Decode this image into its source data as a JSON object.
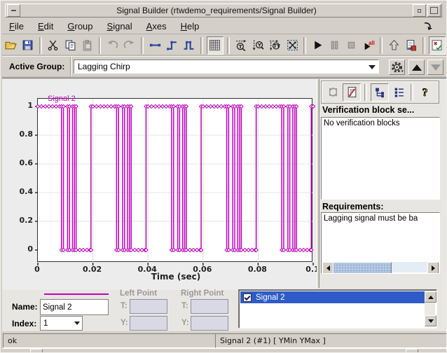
{
  "window": {
    "title": "Signal Builder (rtwdemo_requirements/Signal Builder)"
  },
  "menu": {
    "items": [
      "File",
      "Edit",
      "Group",
      "Signal",
      "Axes",
      "Help"
    ]
  },
  "toolbar": {
    "groups": [
      [
        {
          "name": "open",
          "icon": "folder-open-icon"
        },
        {
          "name": "save",
          "icon": "save-icon"
        }
      ],
      [
        {
          "name": "cut",
          "icon": "scissors-icon"
        },
        {
          "name": "copy",
          "icon": "copy-icon"
        },
        {
          "name": "paste",
          "icon": "paste-icon",
          "disabled": true
        }
      ],
      [
        {
          "name": "undo",
          "icon": "undo-icon",
          "disabled": true
        },
        {
          "name": "redo",
          "icon": "redo-icon",
          "disabled": true
        }
      ],
      [
        {
          "name": "line-segment",
          "icon": "line-segment-icon"
        },
        {
          "name": "step-signal",
          "icon": "step-icon"
        },
        {
          "name": "pulse-signal",
          "icon": "pulse-icon"
        }
      ],
      [
        {
          "name": "grid-toggle",
          "icon": "grid-icon",
          "pressed": true
        }
      ],
      [
        {
          "name": "zoom-time",
          "icon": "zoom-t-icon"
        },
        {
          "name": "zoom-y",
          "icon": "zoom-y-icon"
        },
        {
          "name": "zoom-ty",
          "icon": "zoom-ty-icon"
        },
        {
          "name": "zoom-fit",
          "icon": "zoom-fit-icon"
        }
      ],
      [
        {
          "name": "start-simulation",
          "icon": "play-icon"
        },
        {
          "name": "pause-simulation",
          "icon": "pause-icon",
          "disabled": true
        },
        {
          "name": "stop-simulation",
          "icon": "stop-icon",
          "disabled": true
        },
        {
          "name": "run-all-groups",
          "icon": "play-all-icon"
        }
      ],
      [
        {
          "name": "up-to-parent",
          "icon": "up-arrow-icon"
        },
        {
          "name": "send-to-workspace",
          "icon": "export-icon"
        }
      ],
      [
        {
          "name": "requirements-display",
          "icon": "verification-icon",
          "pressed": true
        }
      ]
    ]
  },
  "active_group": {
    "label": "Active Group:",
    "value": "Lagging Chirp"
  },
  "right_panel": {
    "toolbar": [
      {
        "name": "run-verification",
        "icon": "run-verification-icon",
        "disabled": true
      },
      {
        "name": "requirements-doc",
        "icon": "requirements-doc-icon",
        "pressed": true
      },
      {
        "name": "tree-view",
        "icon": "tree-view-icon",
        "pressed": true
      },
      {
        "name": "list-view",
        "icon": "list-view-icon"
      },
      {
        "name": "help",
        "icon": "help-icon"
      }
    ],
    "verification_header": "Verification block se...",
    "verification_text": "No verification blocks",
    "requirements_header": "Requirements:",
    "requirements_text": "Lagging signal must be ba"
  },
  "signal_panel": {
    "left_point_label": "Left Point",
    "right_point_label": "Right Point",
    "name_label": "Name:",
    "name_value": "Signal 2",
    "index_label": "Index:",
    "index_value": "1",
    "t_label": "T:",
    "y_label": "Y:"
  },
  "signal_list": {
    "items": [
      {
        "label": "Signal 2",
        "checked": true,
        "selected": true
      }
    ]
  },
  "status_bar": {
    "left": "ok",
    "right": "Signal 2 (#1)  [ YMin YMax ]"
  },
  "chart_data": {
    "type": "line",
    "style": "square-wave-with-markers",
    "title": "Signal 2",
    "xlabel": "Time (sec)",
    "color": "#bf00bf",
    "grid": true,
    "xlim": [
      0,
      0.1
    ],
    "ylim": [
      -0.05,
      1.1
    ],
    "xticks": [
      0,
      0.02,
      0.04,
      0.06,
      0.08,
      0.1
    ],
    "xtick_labels": [
      "0",
      "0.02",
      "0.04",
      "0.06",
      "0.08",
      "0.1"
    ],
    "yticks": [
      0,
      0.2,
      0.4,
      0.6,
      0.8,
      1
    ],
    "ytick_labels": [
      "0",
      "0.2",
      "0.4",
      "0.6",
      "0.8",
      "1"
    ],
    "initial_value": 1,
    "end_time": 0.1,
    "block_starts": [
      0,
      0.02,
      0.04,
      0.06,
      0.08
    ],
    "toggle_pattern": [
      0.0086,
      0.0093,
      0.0108,
      0.0115,
      0.0126,
      0.0133,
      0.0139,
      0.0193
    ],
    "top_marker_pattern": [
      0,
      0.0013,
      0.0027,
      0.004,
      0.0053,
      0.0066,
      0.0079
    ],
    "bottom_marker_pattern": [
      0.0152,
      0.0165,
      0.0178,
      0.019
    ]
  }
}
